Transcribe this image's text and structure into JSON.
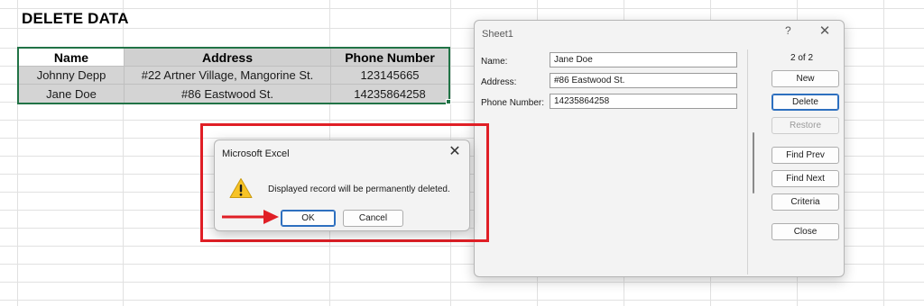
{
  "sheet": {
    "title": "DELETE DATA",
    "table": {
      "headers": [
        "Name",
        "Address",
        "Phone Number"
      ],
      "rows": [
        [
          "Johnny Depp",
          "#22 Artner Village, Mangorine St.",
          "123145665"
        ],
        [
          "Jane Doe",
          "#86 Eastwood St.",
          "14235864258"
        ]
      ]
    }
  },
  "confirm_dialog": {
    "title": "Microsoft Excel",
    "message": "Displayed record will be permanently deleted.",
    "ok_label": "OK",
    "cancel_label": "Cancel",
    "close_glyph": "✕",
    "icon": "warning-icon"
  },
  "data_form": {
    "title": "Sheet1",
    "help_glyph": "?",
    "close_glyph": "✕",
    "record_counter": "2 of 2",
    "fields": [
      {
        "label": "Name:",
        "value": "Jane Doe"
      },
      {
        "label": "Address:",
        "value": "#86 Eastwood St."
      },
      {
        "label": "Phone Number:",
        "value": "14235864258"
      }
    ],
    "buttons": {
      "new": "New",
      "delete": "Delete",
      "restore": "Restore",
      "find_prev": "Find Prev",
      "find_next": "Find Next",
      "criteria": "Criteria",
      "close": "Close"
    }
  },
  "colors": {
    "highlight": "#e01f26",
    "table_border": "#217346",
    "focus_blue": "#2d6fbf"
  }
}
